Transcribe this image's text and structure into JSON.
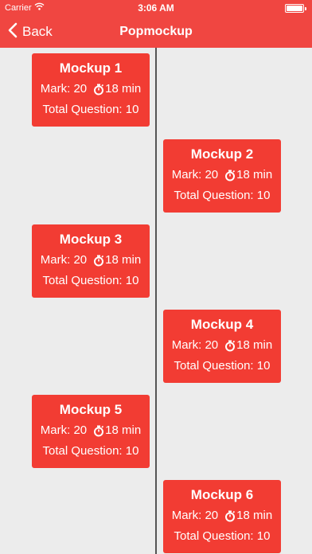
{
  "status_bar": {
    "carrier": "Carrier",
    "time": "3:06 AM"
  },
  "nav": {
    "back_label": "Back",
    "title": "Popmockup"
  },
  "mockups": [
    {
      "name": "Mockup 1",
      "mark": "Mark: 20",
      "duration": "18 min",
      "total": "Total Question: 10"
    },
    {
      "name": "Mockup 2",
      "mark": "Mark: 20",
      "duration": "18 min",
      "total": "Total Question: 10"
    },
    {
      "name": "Mockup 3",
      "mark": "Mark: 20",
      "duration": "18 min",
      "total": "Total Question: 10"
    },
    {
      "name": "Mockup 4",
      "mark": "Mark: 20",
      "duration": "18 min",
      "total": "Total Question: 10"
    },
    {
      "name": "Mockup 5",
      "mark": "Mark: 20",
      "duration": "18 min",
      "total": "Total Question: 10"
    },
    {
      "name": "Mockup 6",
      "mark": "Mark: 20",
      "duration": "18 min",
      "total": "Total Question: 10"
    }
  ],
  "colors": {
    "accent": "#f04641",
    "card": "#f23c33",
    "background": "#ececec"
  },
  "icons": {
    "wifi": "wifi-icon",
    "battery": "battery-icon",
    "back": "chevron-left-icon",
    "timer": "stopwatch-icon"
  }
}
